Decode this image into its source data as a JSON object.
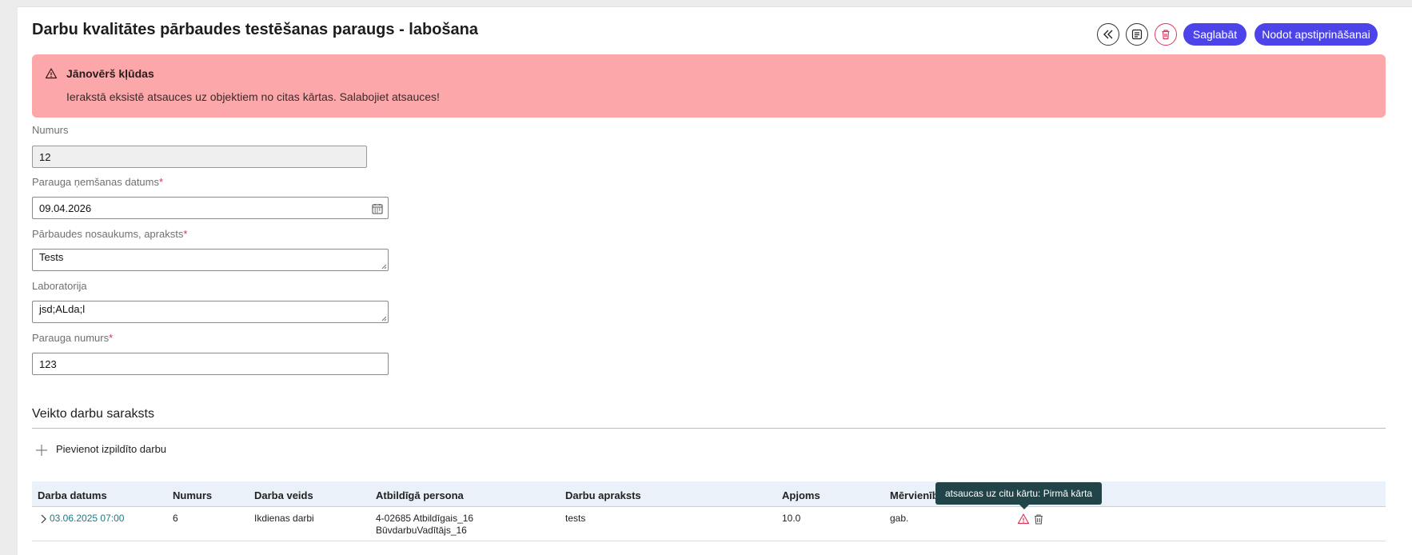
{
  "header": {
    "title": "Darbu kvalitātes pārbaudes testēšanas paraugs - labošana",
    "save_label": "Saglabāt",
    "submit_label": "Nodot apstiprināšanai"
  },
  "alert": {
    "title": "Jānovērš kļūdas",
    "message": "Ierakstā eksistē atsauces uz objektiem no citas kārtas. Salabojiet atsauces!"
  },
  "form": {
    "number_label": "Numurs",
    "number_value": "12",
    "date_label": "Parauga ņemšanas datums",
    "date_value": "09.04.2026",
    "name_label": "Pārbaudes nosaukums, apraksts",
    "name_value": "Tests",
    "lab_label": "Laboratorija",
    "lab_value": "jsd;ALda;l",
    "sample_label": "Parauga numurs",
    "sample_value": "123",
    "required_mark": "*"
  },
  "works": {
    "section_title": "Veikto darbu saraksts",
    "add_label": "Pievienot izpildīto darbu",
    "columns": [
      "Darba datums",
      "Numurs",
      "Darba veids",
      "Atbildīgā persona",
      "Darbu apraksts",
      "Apjoms",
      "Mērvienīb"
    ],
    "rows": [
      {
        "date": "03.06.2025 07:00",
        "number": "6",
        "type": "Ikdienas darbi",
        "person_line1": "4-02685 Atbildīgais_16",
        "person_line2": "BūvdarbuVadītājs_16",
        "description": "tests",
        "amount": "10.0",
        "unit": "gab."
      }
    ],
    "tooltip": "atsaucas uz citu kārtu: Pirmā kārta"
  },
  "colors": {
    "accent": "#4c44e8",
    "alert_bg": "#fca8aa",
    "danger": "#d63b5d",
    "link": "#1a7a85",
    "tooltip_bg": "#214449"
  },
  "icons": [
    "double-chevron-left-icon",
    "document-icon",
    "trash-icon",
    "warning-icon",
    "calendar-icon",
    "plus-icon",
    "chevron-right-icon"
  ]
}
